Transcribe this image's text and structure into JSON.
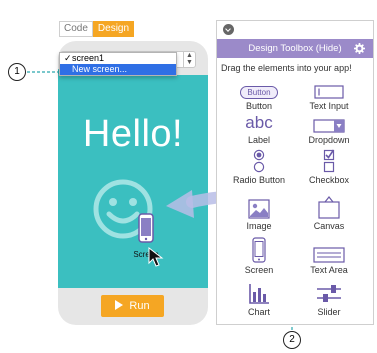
{
  "mode_toggle": {
    "code": "Code",
    "design": "Design"
  },
  "screen_dropdown": {
    "items": [
      {
        "label": "screen1",
        "selected": true
      },
      {
        "label": "New screen...",
        "highlighted": true
      }
    ]
  },
  "screen": {
    "hello_text": "Hello!",
    "dragged_label": "Screen"
  },
  "run_button": {
    "label": "Run"
  },
  "toolbox": {
    "title": "Design Toolbox (Hide)",
    "hint": "Drag the elements into your app!",
    "tools": [
      {
        "label": "Button",
        "icon": "button-pill-icon",
        "pill_text": "Button"
      },
      {
        "label": "Text Input",
        "icon": "text-input-icon"
      },
      {
        "label": "Label",
        "icon": "label-abc-icon",
        "glyph": "abc"
      },
      {
        "label": "Dropdown",
        "icon": "dropdown-icon"
      },
      {
        "label": "Radio Button",
        "icon": "radio-button-icon"
      },
      {
        "label": "Checkbox",
        "icon": "checkbox-icon"
      },
      {
        "label": "Image",
        "icon": "image-icon"
      },
      {
        "label": "Canvas",
        "icon": "canvas-icon"
      },
      {
        "label": "Screen",
        "icon": "phone-screen-icon"
      },
      {
        "label": "Text Area",
        "icon": "text-area-icon"
      },
      {
        "label": "Chart",
        "icon": "chart-icon"
      },
      {
        "label": "Slider",
        "icon": "slider-icon"
      }
    ]
  },
  "callouts": {
    "one": "1",
    "two": "2"
  },
  "colors": {
    "accent": "#f5a623",
    "toolbox_header": "#9b8ac9",
    "screen_bg": "#3bbfc0",
    "icon": "#6a5aa8"
  }
}
